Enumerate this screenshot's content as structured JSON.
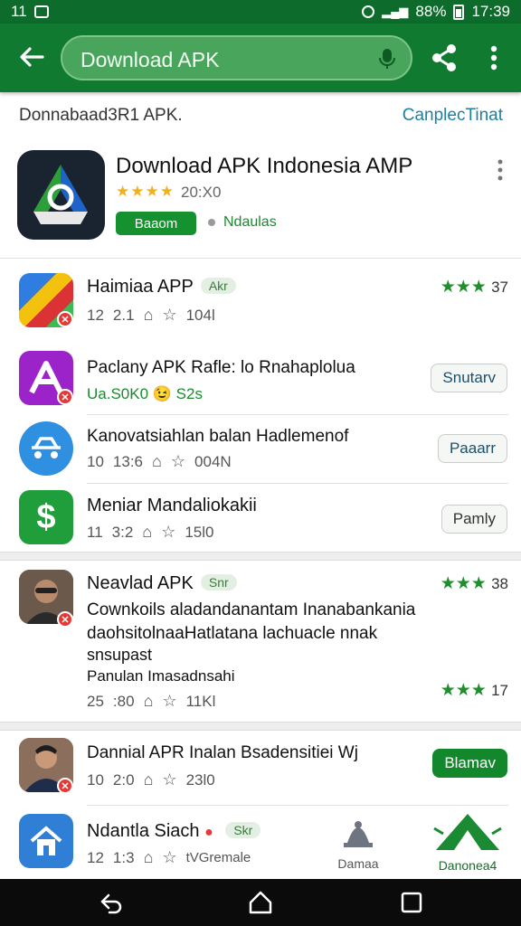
{
  "status_bar": {
    "left_text": "11",
    "battery": "88%",
    "time": "17:39"
  },
  "app_bar": {
    "search_text": "Download APK",
    "icons": [
      "back-arrow-icon",
      "mic-icon",
      "share-icon",
      "overflow-menu-icon"
    ]
  },
  "subheader": {
    "left": "Donnabaad3R1 APK.",
    "right": "CanplecTinat"
  },
  "featured": {
    "title": "Download APK Indonesia AMP",
    "stars": "★★★★",
    "rating": "20:X0",
    "install_label": "Baaom",
    "category": "Ndaulas"
  },
  "apps": [
    {
      "title": "Haimiaa APP",
      "tag": "Akr",
      "meta_a": "12",
      "meta_b": "2.1",
      "meta_c": "104l",
      "stars": "★★★",
      "rating": "37"
    },
    {
      "title": "Paclany APK Rafle: lo Rnahaplolua",
      "subtitle": "Ua.S0K0 😉 S2s",
      "button": "Snutarv"
    },
    {
      "title": "Kanovatsiahlan balan Hadlemenof",
      "meta_a": "10",
      "meta_b": "13:6",
      "meta_c": "004N",
      "button": "Paaarr"
    },
    {
      "title": "Meniar Mandaliokakii",
      "meta_a": "11",
      "meta_b": "3:2",
      "meta_c": "15l0",
      "button": "Pamly"
    }
  ],
  "news": {
    "title": "Neavlad APK",
    "tag": "Snr",
    "stars": "★★★",
    "rating": "38",
    "line1": "Cownkoils aladandanantam Inanabankania",
    "line2": "daohsitolnaaHatlatana lachuacle nnak",
    "line3": "snsupast",
    "line4": "Panulan Imasadnsahi",
    "meta_a": "25",
    "meta_b": ":80",
    "meta_c": "11Kl",
    "stars2": "★★★",
    "rating2": "17"
  },
  "bottom_apps": [
    {
      "title": "Dannial APR Inalan Bsadensitiei Wj",
      "meta_a": "10",
      "meta_b": "2:0",
      "meta_c": "23l0",
      "button": "Blamav"
    },
    {
      "title": "Ndantla Siach",
      "tag": "Skr",
      "meta_a": "12",
      "meta_b": "1:3",
      "meta_c": "tVGremale",
      "tab_a": "Damaa",
      "tab_b": "Danonea4"
    }
  ],
  "colors": {
    "status_bar": "#0d6b2b",
    "app_bar": "#0f7a30",
    "accent_green": "#12872c",
    "link_blue": "#1e7f9e",
    "star_yellow": "#f2b01e"
  }
}
